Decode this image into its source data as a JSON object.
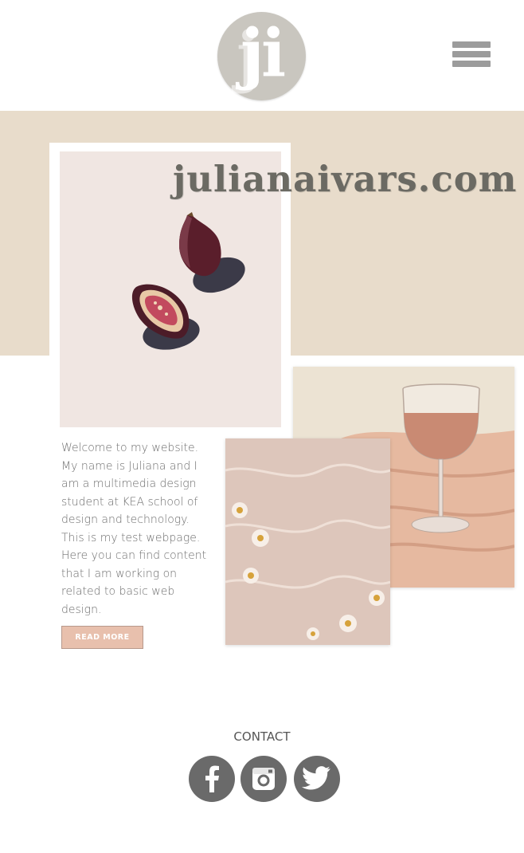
{
  "header": {
    "logo": {
      "text": "ji",
      "icon": "ji-monogram-logo",
      "color": "#c9c6bf"
    },
    "menu_icon": "hamburger-menu-icon"
  },
  "hero": {
    "title": "julianaivars.com",
    "band_color": "#e8dccb"
  },
  "images": {
    "figs": "fig-halves-photo",
    "wine": "rose-wine-glass-photo",
    "water": "daisies-in-water-photo"
  },
  "intro": {
    "text": "Welcome to my website. My name is Juliana and I am a multimedia design student at KEA school of design and technology. This is my test webpage. Here you can find content that I am working on related to basic web design.",
    "button_label": "READ MORE",
    "button_color": "#e8c0ad"
  },
  "contact": {
    "label": "CONTACT",
    "social": [
      {
        "name": "facebook",
        "icon": "facebook-icon"
      },
      {
        "name": "instagram",
        "icon": "instagram-icon"
      },
      {
        "name": "twitter",
        "icon": "twitter-icon"
      }
    ]
  }
}
